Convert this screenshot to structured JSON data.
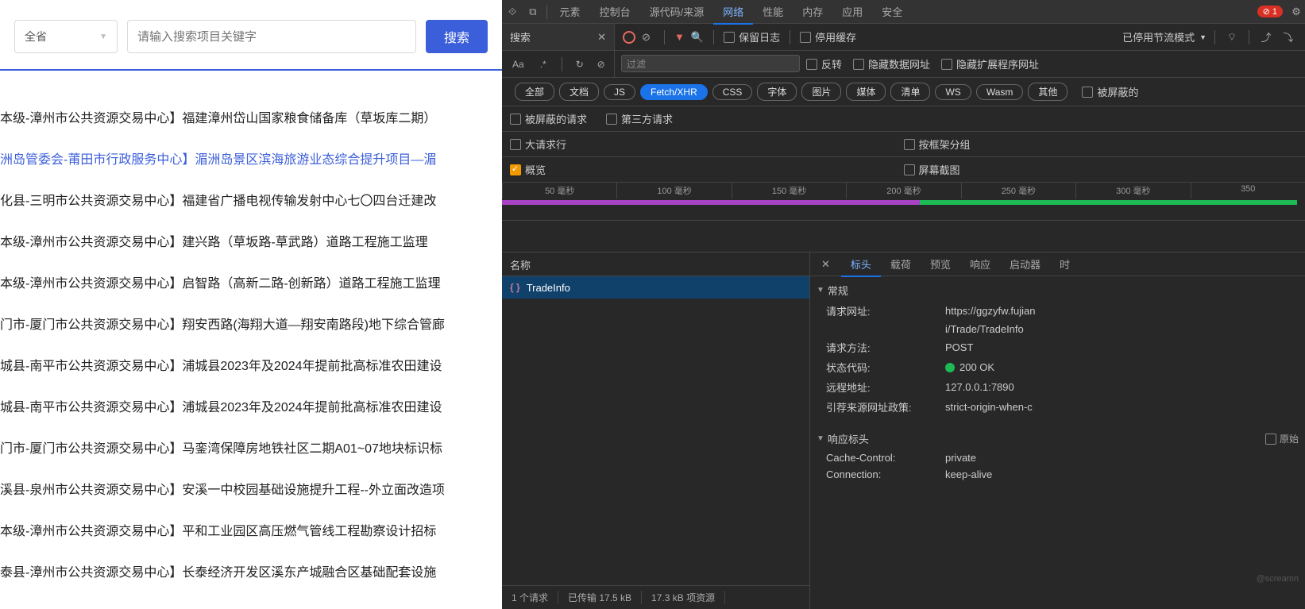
{
  "left": {
    "province": "全省",
    "placeholder": "请输入搜索项目关键字",
    "search_btn": "搜索",
    "results": [
      "本级-漳州市公共资源交易中心】福建漳州岱山国家粮食储备库（草坂库二期）",
      "洲岛管委会-莆田市行政服务中心】湄洲岛景区滨海旅游业态综合提升项目—湄",
      "化县-三明市公共资源交易中心】福建省广播电视传输发射中心七〇四台迁建改",
      "本级-漳州市公共资源交易中心】建兴路（草坂路-草武路）道路工程施工监理",
      "本级-漳州市公共资源交易中心】启智路（高新二路-创新路）道路工程施工监理",
      "门市-厦门市公共资源交易中心】翔安西路(海翔大道—翔安南路段)地下综合管廊",
      "城县-南平市公共资源交易中心】浦城县2023年及2024年提前批高标准农田建设",
      "城县-南平市公共资源交易中心】浦城县2023年及2024年提前批高标准农田建设",
      "门市-厦门市公共资源交易中心】马銮湾保障房地铁社区二期A01~07地块标识标",
      "溪县-泉州市公共资源交易中心】安溪一中校园基础设施提升工程--外立面改造项",
      "本级-漳州市公共资源交易中心】平和工业园区高压燃气管线工程勘察设计招标",
      "泰县-漳州市公共资源交易中心】长泰经济开发区溪东产城融合区基础配套设施"
    ],
    "active_index": 1
  },
  "devtools": {
    "tabs": [
      "元素",
      "控制台",
      "源代码/来源",
      "网络",
      "性能",
      "内存",
      "应用",
      "安全"
    ],
    "active_tab": "网络",
    "error_count": "1",
    "search_label": "搜索",
    "toolbar": {
      "preserve_log": "保留日志",
      "disable_cache": "停用缓存",
      "throttle": "已停用节流模式"
    },
    "search_opts": {
      "aa": "Aa",
      "regex": ".*"
    },
    "filter_placeholder": "过滤",
    "filter_opts": {
      "invert": "反转",
      "hide_data": "隐藏数据网址",
      "hide_ext": "隐藏扩展程序网址"
    },
    "chips": [
      "全部",
      "文档",
      "JS",
      "Fetch/XHR",
      "CSS",
      "字体",
      "图片",
      "媒体",
      "清单",
      "WS",
      "Wasm",
      "其他"
    ],
    "active_chip": "Fetch/XHR",
    "blocked_cookies": "被屏蔽的",
    "row5": {
      "blocked_req": "被屏蔽的请求",
      "third_party": "第三方请求"
    },
    "row6": {
      "big_req": "大请求行",
      "group_frame": "按框架分组",
      "overview": "概览",
      "screenshots": "屏幕截图"
    },
    "timeline_ticks": [
      "50 毫秒",
      "100 毫秒",
      "150 毫秒",
      "200 毫秒",
      "250 毫秒",
      "300 毫秒",
      "350"
    ],
    "name_header": "名称",
    "request_name": "TradeInfo",
    "footer": {
      "reqs": "1 个请求",
      "transferred": "已传输 17.5 kB",
      "resources": "17.3 kB 项资源"
    },
    "detail_tabs": [
      "标头",
      "载荷",
      "预览",
      "响应",
      "启动器",
      "时"
    ],
    "active_detail": "标头",
    "general_header": "常规",
    "general": [
      {
        "k": "请求网址:",
        "v": "https://ggzyfw.fujian"
      },
      {
        "k": "",
        "v": "i/Trade/TradeInfo"
      },
      {
        "k": "请求方法:",
        "v": "POST"
      },
      {
        "k": "状态代码:",
        "v": "200 OK",
        "dot": true
      },
      {
        "k": "远程地址:",
        "v": "127.0.0.1:7890"
      },
      {
        "k": "引荐来源网址政策:",
        "v": "strict-origin-when-c"
      }
    ],
    "response_header": "响应标头",
    "raw_label": "原始",
    "response": [
      {
        "k": "Cache-Control:",
        "v": "private"
      },
      {
        "k": "Connection:",
        "v": "keep-alive"
      }
    ],
    "watermark": "@screamn"
  }
}
